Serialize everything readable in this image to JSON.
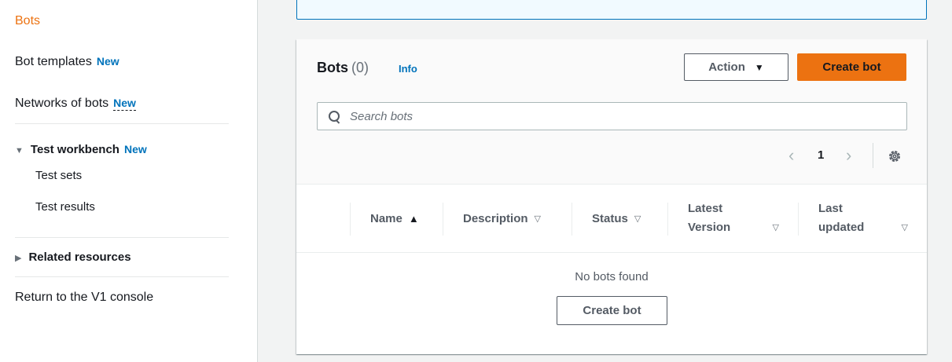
{
  "sidebar": {
    "bots": "Bots",
    "bot_templates": "Bot templates",
    "bot_templates_badge": "New",
    "networks": "Networks of bots",
    "networks_badge": "New",
    "test_workbench": "Test workbench",
    "test_workbench_badge": "New",
    "test_sets": "Test sets",
    "test_results": "Test results",
    "related_resources": "Related resources",
    "return_v1": "Return to the V1 console"
  },
  "bots_panel": {
    "title": "Bots",
    "count": "(0)",
    "info": "Info",
    "action_label": "Action",
    "create_label": "Create bot",
    "search_placeholder": "Search bots",
    "page": "1",
    "columns": [
      {
        "label": "Name",
        "sort": "ascending"
      },
      {
        "label": "Description",
        "sort": "none"
      },
      {
        "label": "Status",
        "sort": "none"
      },
      {
        "label": "Latest Version",
        "line1": "Latest",
        "line2": "Version",
        "sort": "none"
      },
      {
        "label": "Last updated",
        "line1": "Last",
        "line2": "updated",
        "sort": "none"
      }
    ],
    "empty_text": "No bots found",
    "empty_create_label": "Create bot"
  },
  "colors": {
    "accent": "#ec7211",
    "link": "#0073bb",
    "text": "#16191f"
  }
}
